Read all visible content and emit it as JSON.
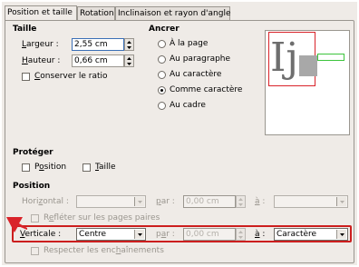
{
  "tabs": [
    "Position et taille",
    "Rotation",
    "Inclinaison et rayon d'angle"
  ],
  "size": {
    "header": "Taille",
    "width_label": "Largeur :",
    "width_value": "2,55 cm",
    "height_label": "Hauteur :",
    "height_value": "0,66 cm",
    "keep_ratio_label": "Conserver le ratio",
    "keep_ratio_checked": false
  },
  "anchor": {
    "header": "Ancrer",
    "options": [
      "À la page",
      "Au paragraphe",
      "Au caractère",
      "Comme caractère",
      "Au cadre"
    ],
    "selected": "Comme caractère"
  },
  "preview": {
    "glyph": "Ij"
  },
  "protect": {
    "header": "Protéger",
    "position_label": "Position",
    "size_label": "Taille"
  },
  "position": {
    "header": "Position",
    "horizontal_label": "Horizontal :",
    "horizontal_by_label": "par :",
    "horizontal_by_value": "0,00 cm",
    "horizontal_to_label": "à :",
    "mirror_label": "Refléter sur les pages paires",
    "vertical_label": "Verticale :",
    "vertical_value": "Centre",
    "vertical_by_label": "par :",
    "vertical_by_value": "0,00 cm",
    "vertical_to_label": "à :",
    "vertical_to_value": "Caractère",
    "follow_flow_label": "Respecter les enchaînements"
  },
  "colors": {
    "highlight_red": "#cc1e1e",
    "preview_red": "#d9232a",
    "preview_green": "#3cc43c",
    "preview_gray": "#a8a8a8"
  }
}
